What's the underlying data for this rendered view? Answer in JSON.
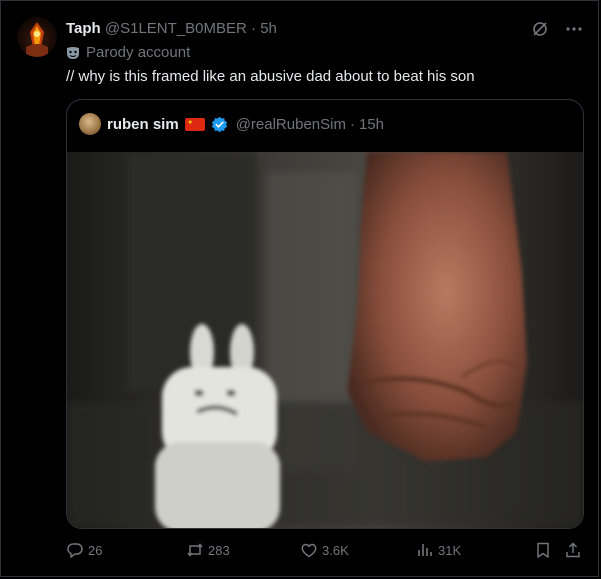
{
  "post": {
    "author_name": "Taph",
    "author_handle": "@S1LENT_B0MBER",
    "separator": "·",
    "time": "5h",
    "parody_label": "Parody account",
    "text": "// why is this framed like an abusive dad about to beat his son"
  },
  "quoted": {
    "author_name": "ruben sim",
    "author_handle": "@realRubenSim",
    "separator": "·",
    "time": "15h"
  },
  "actions": {
    "replies": "26",
    "reposts": "283",
    "likes": "3.6K",
    "views": "31K"
  },
  "icons": {
    "more": "more-icon",
    "grok": "grok-icon",
    "reply": "reply-icon",
    "repost": "repost-icon",
    "like": "like-icon",
    "views": "views-icon",
    "bookmark": "bookmark-icon",
    "share": "share-icon",
    "verified": "verified-badge-icon",
    "flag": "china-flag-icon",
    "parody": "mask-icon"
  },
  "colors": {
    "background": "#000000",
    "border": "#2f3336",
    "primary_text": "#e7e9ea",
    "secondary_text": "#71767b",
    "verified": "#1d9bf0"
  }
}
